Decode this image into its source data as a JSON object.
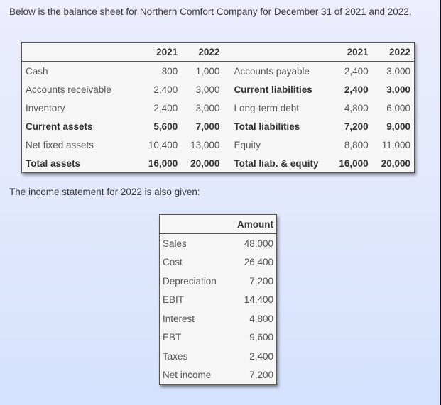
{
  "intro": "Below is the balance sheet for Northern Comfort Company for December 31 of 2021 and 2022.",
  "balance_sheet": {
    "headers": {
      "left_2021": "2021",
      "left_2022": "2022",
      "right_2021": "2021",
      "right_2022": "2022"
    },
    "rows": [
      {
        "asset": "Cash",
        "a2021": "800",
        "a2022": "1,000",
        "liab": "Accounts payable",
        "l2021": "2,400",
        "l2022": "3,000",
        "asset_bold": false,
        "liab_bold": false
      },
      {
        "asset": "Accounts receivable",
        "a2021": "2,400",
        "a2022": "3,000",
        "liab": "Current liabilities",
        "l2021": "2,400",
        "l2022": "3,000",
        "asset_bold": false,
        "liab_bold": true
      },
      {
        "asset": "Inventory",
        "a2021": "2,400",
        "a2022": "3,000",
        "liab": "Long-term debt",
        "l2021": "4,800",
        "l2022": "6,000",
        "asset_bold": false,
        "liab_bold": false
      },
      {
        "asset": "Current assets",
        "a2021": "5,600",
        "a2022": "7,000",
        "liab": "Total liabilities",
        "l2021": "7,200",
        "l2022": "9,000",
        "asset_bold": true,
        "liab_bold": true
      },
      {
        "asset": "Net fixed assets",
        "a2021": "10,400",
        "a2022": "13,000",
        "liab": "Equity",
        "l2021": "8,800",
        "l2022": "11,000",
        "asset_bold": false,
        "liab_bold": false
      },
      {
        "asset": "Total assets",
        "a2021": "16,000",
        "a2022": "20,000",
        "liab": "Total liab. & equity",
        "l2021": "16,000",
        "l2022": "20,000",
        "asset_bold": true,
        "liab_bold": true
      }
    ]
  },
  "mid_text": "The income statement for 2022 is also given:",
  "income_statement": {
    "header": "Amount",
    "rows": [
      {
        "label": "Sales",
        "amount": "48,000"
      },
      {
        "label": "Cost",
        "amount": "26,400"
      },
      {
        "label": "Depreciation",
        "amount": "7,200"
      },
      {
        "label": "EBIT",
        "amount": "14,400"
      },
      {
        "label": "Interest",
        "amount": "4,800"
      },
      {
        "label": "EBT",
        "amount": "9,600"
      },
      {
        "label": "Taxes",
        "amount": "2,400"
      },
      {
        "label": "Net income",
        "amount": "7,200"
      }
    ]
  }
}
